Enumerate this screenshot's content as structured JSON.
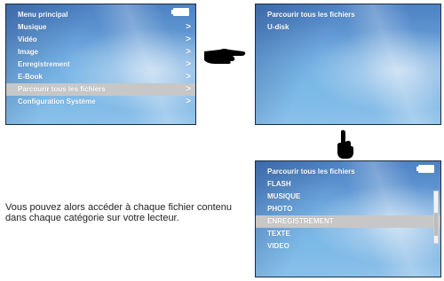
{
  "screen_main": {
    "title": "Menu principal",
    "items": [
      {
        "label": "Musique",
        "arrow": ">"
      },
      {
        "label": "Vidéo",
        "arrow": ">"
      },
      {
        "label": "Image",
        "arrow": ">"
      },
      {
        "label": "Enregistrement",
        "arrow": ">"
      },
      {
        "label": "E-Book",
        "arrow": ">"
      },
      {
        "label": "Parcourir tous les fichiers",
        "arrow": ">",
        "selected": true
      },
      {
        "label": "Configuration Système",
        "arrow": ">"
      }
    ]
  },
  "screen_browse": {
    "title": "Parcourir tous les fichiers",
    "items": [
      {
        "label": "U-disk"
      }
    ]
  },
  "screen_categories": {
    "title": "Parcourir tous les fichiers",
    "items": [
      {
        "label": "FLASH"
      },
      {
        "label": "MUSIQUE"
      },
      {
        "label": "PHOTO"
      },
      {
        "label": "ENREGISTREMENT",
        "selected": true
      },
      {
        "label": "TEXTE"
      },
      {
        "label": "VIDEO"
      }
    ]
  },
  "description": "Vous pouvez alors accéder à chaque fichier contenu dans chaque catégorie sur votre lecteur.",
  "icons": {
    "hand_right": "pointing-hand-right-icon",
    "hand_down": "pointing-hand-down-icon",
    "battery": "battery-icon"
  },
  "colors": {
    "selection": "#c7c7c7",
    "screen_text": "#ffffff"
  }
}
